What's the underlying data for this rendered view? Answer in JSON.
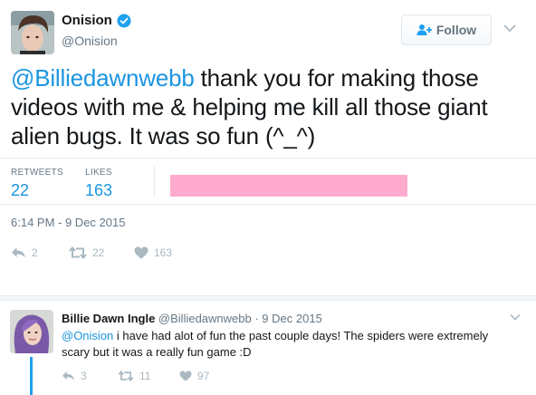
{
  "tweet": {
    "name": "Onision",
    "handle": "@Onision",
    "follow_label": "Follow",
    "mention": "@Billiedawnwebb",
    "text": " thank you for making those videos with me & helping me kill all those giant alien bugs. It was so fun (^_^)",
    "stats": {
      "retweets_label": "RETWEETS",
      "retweets_count": "22",
      "likes_label": "LIKES",
      "likes_count": "163"
    },
    "timestamp": "6:14 PM - 9 Dec 2015",
    "actions": {
      "reply_count": "2",
      "retweet_count": "22",
      "like_count": "163"
    }
  },
  "reply": {
    "name": "Billie Dawn Ingle",
    "handle": "@Billiedawnwebb",
    "separator": " · ",
    "date": "9 Dec 2015",
    "mention": "@Onision",
    "text": " i have had alot of fun the past couple days! The spiders were extremely scary but it was a really fun game :D",
    "actions": {
      "reply_count": "3",
      "retweet_count": "11",
      "like_count": "97"
    }
  },
  "colors": {
    "link_blue": "#1b95e0",
    "thread_blue": "#1da1f2",
    "muted": "#657786",
    "icon_gray": "#aab8c2",
    "liker_faces_band": "#ffabcd"
  },
  "icons": [
    "verified-icon",
    "follow-person-icon",
    "chevron-down-icon",
    "reply-icon",
    "retweet-icon",
    "heart-icon"
  ]
}
